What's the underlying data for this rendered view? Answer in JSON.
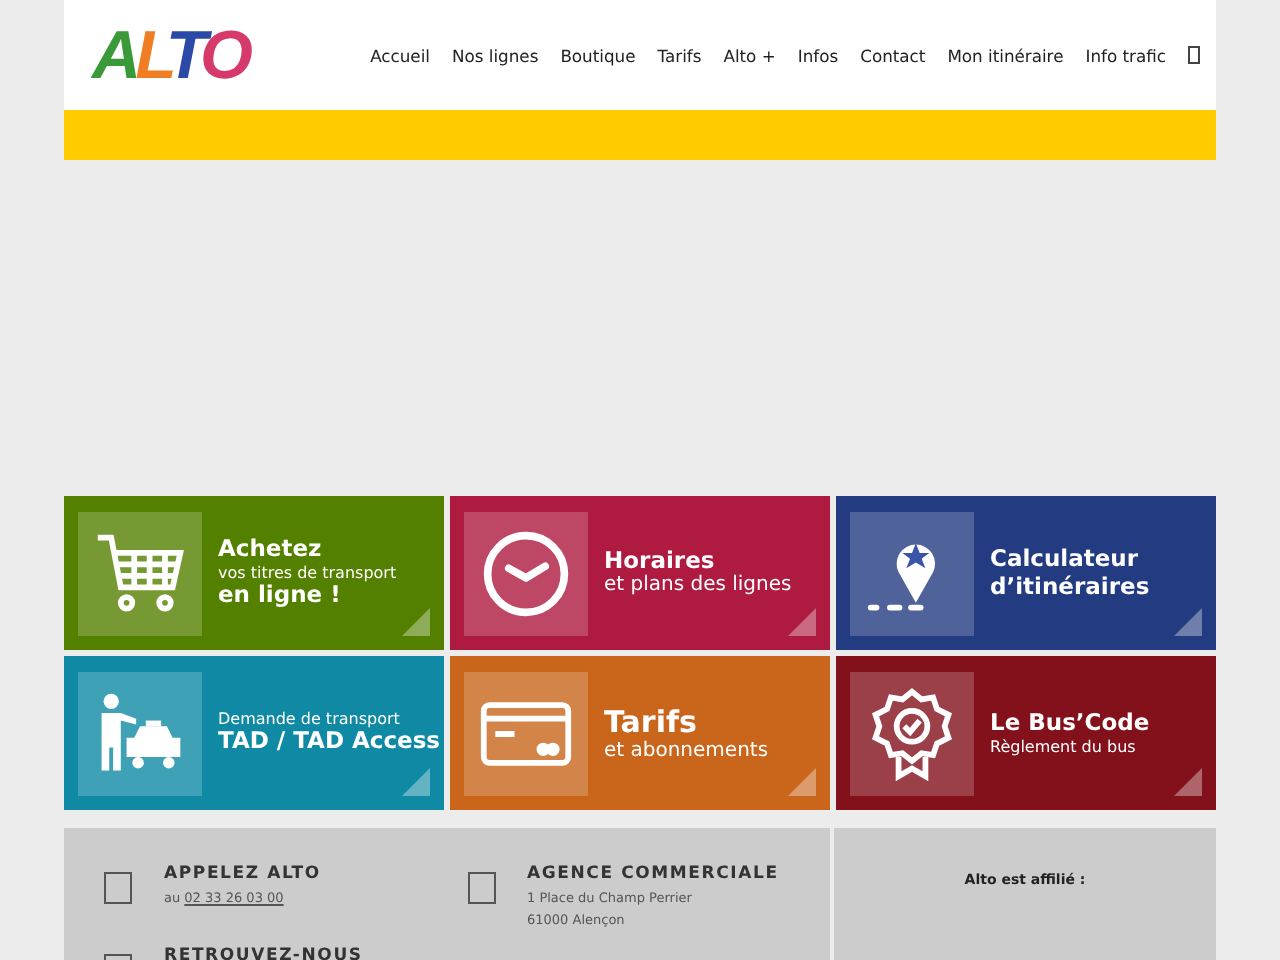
{
  "logo": {
    "letters": [
      {
        "char": "A",
        "color": "#3a9a3a"
      },
      {
        "char": "L",
        "color": "#f07d22"
      },
      {
        "char": "T",
        "color": "#2b4aa8"
      },
      {
        "char": "O",
        "color": "#d63a6a"
      }
    ]
  },
  "nav": {
    "items": [
      "Accueil",
      "Nos lignes",
      "Boutique",
      "Tarifs",
      "Alto +",
      "Infos",
      "Contact",
      "Mon itinéraire",
      "Info trafic"
    ]
  },
  "tiles": [
    {
      "color": "#548000",
      "lines": [
        {
          "kind": "big",
          "text": "Achetez"
        },
        {
          "kind": "small",
          "text": "vos titres de transport"
        },
        {
          "kind": "big",
          "text": "en ligne !"
        }
      ]
    },
    {
      "color": "#ae1a40",
      "lines": [
        {
          "kind": "big",
          "text": "Horaires"
        },
        {
          "kind": "medium",
          "text": "et plans des lignes"
        }
      ]
    },
    {
      "color": "#233b80",
      "lines": [
        {
          "kind": "big",
          "text": "Calculateur"
        },
        {
          "kind": "big",
          "text": "d’itinéraires"
        }
      ]
    },
    {
      "color": "#108aa4",
      "lines": [
        {
          "kind": "small",
          "text": "Demande de transport"
        },
        {
          "kind": "big",
          "text": "TAD / TAD Access"
        }
      ]
    },
    {
      "color": "#c9661c",
      "lines": [
        {
          "kind": "huge",
          "text": "Tarifs"
        },
        {
          "kind": "medium",
          "text": "et abonnements"
        }
      ]
    },
    {
      "color": "#82111c",
      "lines": [
        {
          "kind": "big",
          "text": "Le Bus’Code"
        },
        {
          "kind": "small",
          "text": "Règlement du bus"
        }
      ]
    }
  ],
  "footer": {
    "contacts": [
      {
        "title": "APPELEZ ALTO",
        "prefix": "au",
        "phone": "02 33 26 03 00"
      },
      {
        "title": "AGENCE COMMERCIALE",
        "lines": [
          "1 Place du Champ Perrier",
          "61000 Alençon"
        ]
      },
      {
        "title": "RETROUVEZ-NOUS"
      }
    ],
    "affiliation": "Alto est affilié :"
  }
}
